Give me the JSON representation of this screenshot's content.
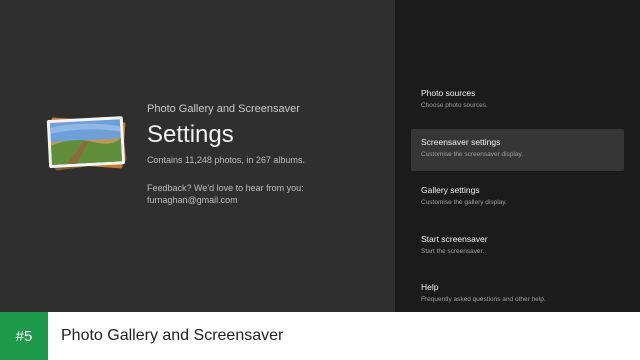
{
  "header": {
    "app_name": "Photo Gallery and Screensaver",
    "title": "Settings",
    "summary": "Contains 11,248 photos, in 267 albums.",
    "feedback": "Feedback? We'd love to hear from you:",
    "email": "furnaghan@gmail.com"
  },
  "menu": {
    "items": [
      {
        "label": "Photo sources",
        "sub": "Choose photo sources."
      },
      {
        "label": "Screensaver settings",
        "sub": "Customise the screensaver display."
      },
      {
        "label": "Gallery settings",
        "sub": "Customise the gallery display."
      },
      {
        "label": "Start screensaver",
        "sub": "Start the screensaver."
      },
      {
        "label": "Help",
        "sub": "Frequently asked questions and other help."
      }
    ],
    "selected_index": 1
  },
  "bottom_bar": {
    "rank": "#5",
    "title": "Photo Gallery and Screensaver"
  },
  "colors": {
    "rank_badge": "#1d9a4a",
    "left_panel": "#2f2f2f",
    "right_panel": "#1b1b1b",
    "selected_item": "#363636"
  },
  "icons": {
    "app_icon": "photo-stack-icon"
  }
}
